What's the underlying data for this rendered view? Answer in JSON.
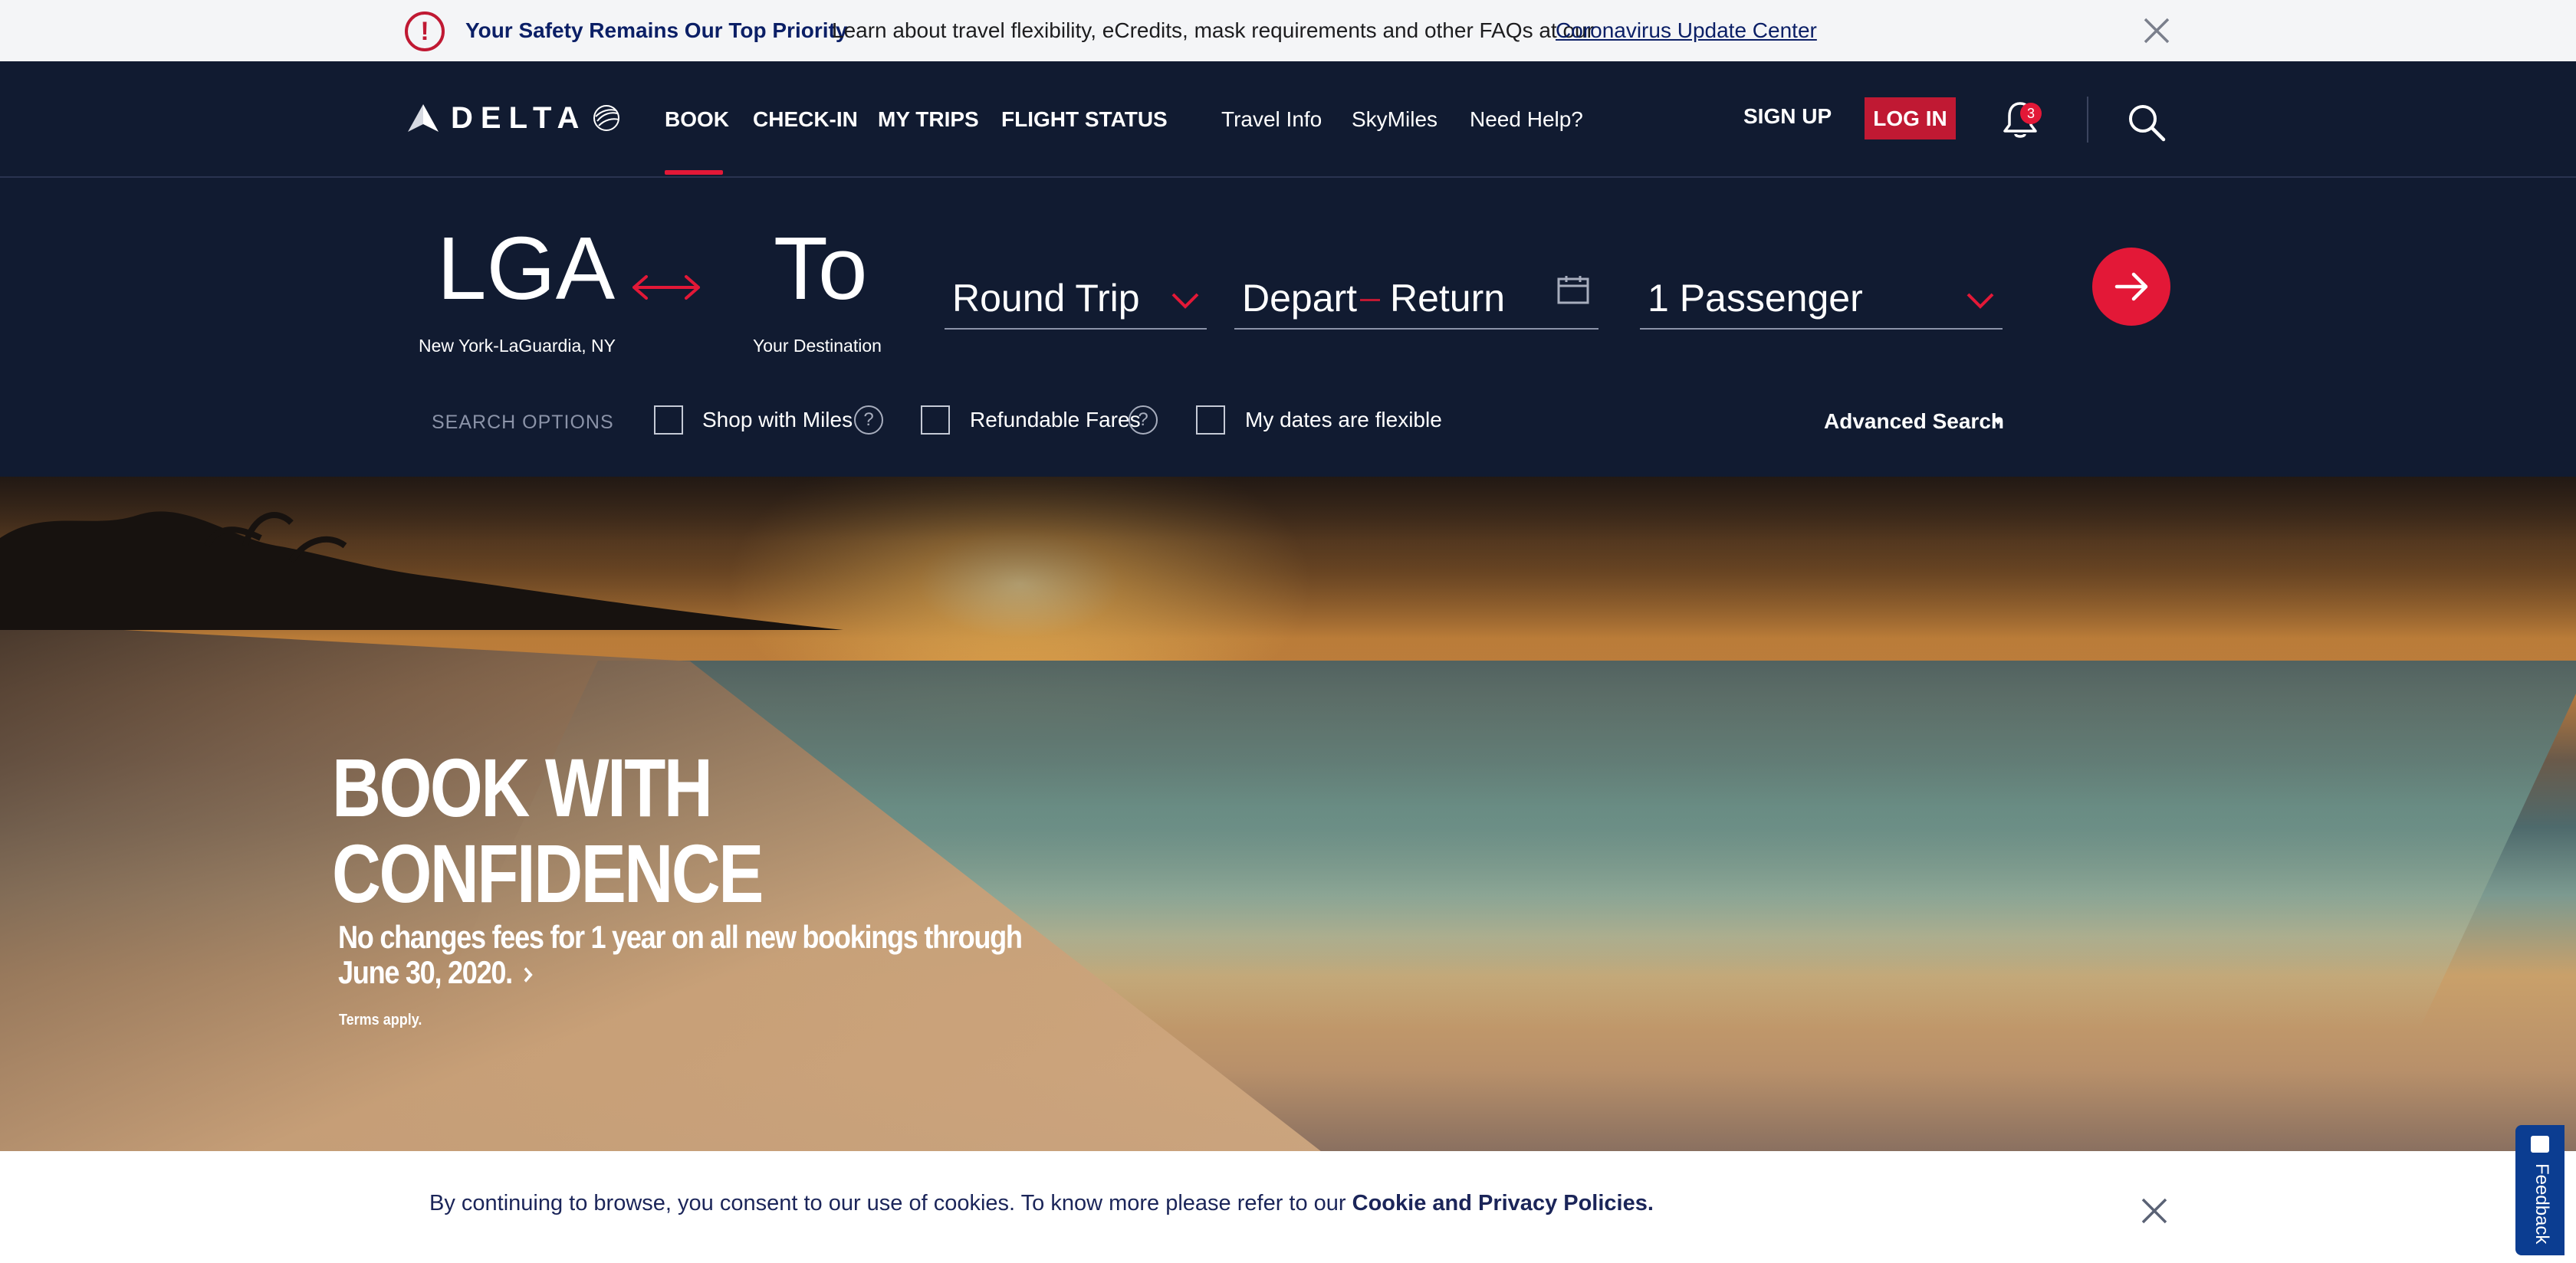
{
  "alert": {
    "title": "Your Safety Remains Our Top Priority",
    "text": "Learn about travel flexibility, eCredits, mask requirements and other FAQs at our",
    "link": "Coronavirus Update Center",
    "icon": "exclamation-circle-icon"
  },
  "header": {
    "logo_text": "DELTA",
    "nav": [
      "BOOK",
      "CHECK-IN",
      "MY TRIPS",
      "FLIGHT STATUS"
    ],
    "secondary_nav": [
      "Travel Info",
      "SkyMiles",
      "Need Help?"
    ],
    "active_nav": "BOOK",
    "signup": "SIGN UP",
    "login": "LOG IN",
    "notification_count": "3"
  },
  "booking": {
    "origin_code": "LGA",
    "origin_name": "New York-LaGuardia, NY",
    "destination_code": "To",
    "destination_name": "Your Destination",
    "trip_type": "Round Trip",
    "depart_label": "Depart",
    "return_label": "Return",
    "passengers": "1 Passenger",
    "search_options_label": "SEARCH OPTIONS",
    "options": [
      {
        "label": "Shop with Miles",
        "checked": false,
        "has_help": true
      },
      {
        "label": "Refundable Fares",
        "checked": false,
        "has_help": true
      },
      {
        "label": "My dates are flexible",
        "checked": false,
        "has_help": false
      }
    ],
    "help_glyph": "?",
    "advanced_search": "Advanced Search"
  },
  "hero": {
    "title_line1": "BOOK WITH",
    "title_line2": "CONFIDENCE",
    "subtitle_line1": "No changes fees for 1 year on all new bookings through",
    "subtitle_line2": "June 30, 2020.",
    "terms": "Terms apply."
  },
  "cookie": {
    "text": "By continuing to browse, you consent to our use of cookies. To know more please refer to our",
    "link": "Cookie and Privacy Policies."
  },
  "feedback": {
    "label": "Feedback"
  },
  "colors": {
    "navy": "#111b31",
    "red": "#e31837",
    "login_red": "#c01933",
    "link_blue": "#0b1f66"
  }
}
